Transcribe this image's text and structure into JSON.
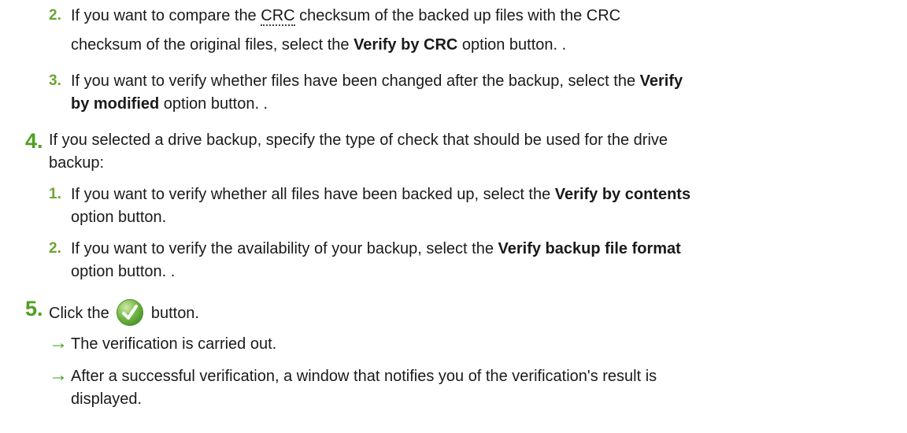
{
  "step4": {
    "number": "4.",
    "line1": "If you selected a drive backup, specify the type of check that should be used for the drive",
    "line2": "backup:",
    "sub1": {
      "number": "1.",
      "pre": "If you want to verify whether all files have been backed up, select the ",
      "bold": "Verify by contents",
      "line2": "option button."
    },
    "sub2": {
      "number": "2.",
      "pre": "If you want to verify the availability of your backup, select the ",
      "bold": "Verify backup file format",
      "line2": "option button. ."
    }
  },
  "step5": {
    "number": "5.",
    "pre": "Click the",
    "post": "button.",
    "icon": "green-checkmark-icon",
    "results": [
      {
        "arrow": "→",
        "text": "The verification is carried out."
      },
      {
        "arrow": "→",
        "line1": "After a successful verification, a window that notifies you of the verification's result is",
        "line2": "displayed."
      }
    ]
  },
  "top": {
    "sub2": {
      "number": "2.",
      "pre": "If you want to compare the ",
      "abbr": "CRC",
      "post": " checksum of the backed up files with the CRC",
      "line2_pre": "checksum of the original files, select the ",
      "line2_bold": "Verify by CRC",
      "line2_post": " option button. ."
    },
    "sub3": {
      "number": "3.",
      "pre": "If you want to verify whether files have been changed after the backup, select the ",
      "bold": "Verify",
      "line2_bold": "by modified",
      "line2_post": " option button. ."
    }
  },
  "colors": {
    "accent": "#4f9f22",
    "sub_accent": "#6aa52f",
    "text": "#1a1a1a"
  }
}
